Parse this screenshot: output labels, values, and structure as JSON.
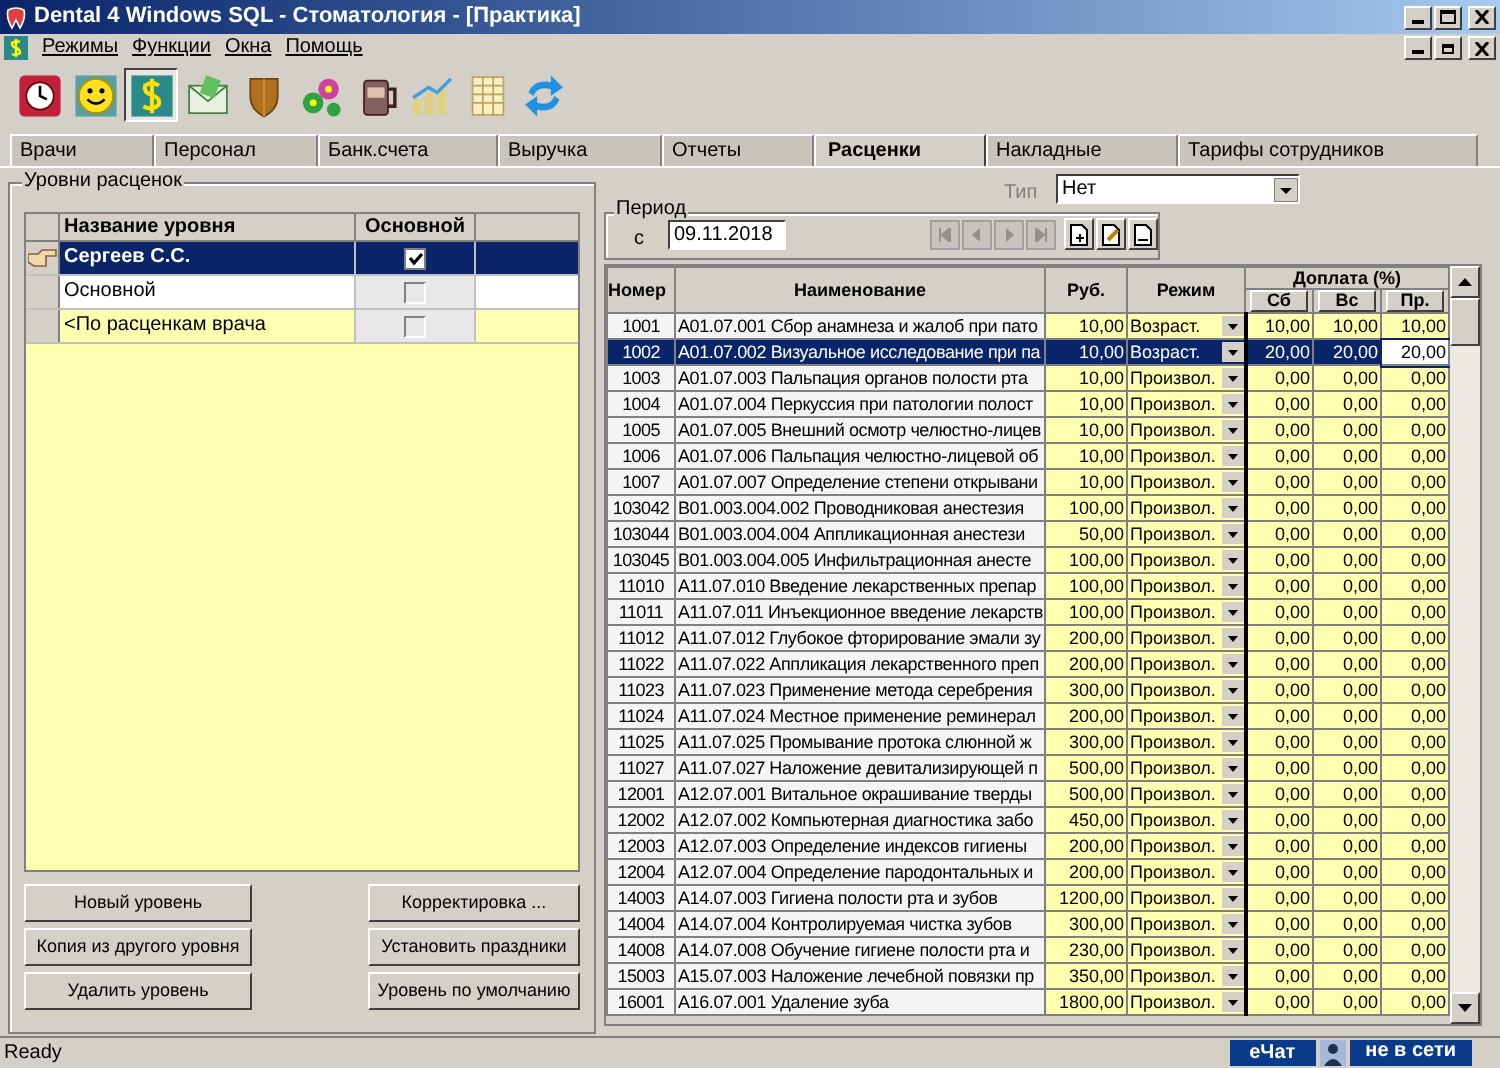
{
  "window": {
    "title": "Dental 4 Windows SQL - Стоматология - [Практика]"
  },
  "menu": [
    "Режимы",
    "Функции",
    "Окна",
    "Помощь"
  ],
  "toolbar": [
    {
      "kind": "clock",
      "selected": false
    },
    {
      "kind": "smiley",
      "selected": false
    },
    {
      "kind": "dollar",
      "selected": true
    },
    {
      "kind": "envelope",
      "selected": false
    },
    {
      "kind": "shield",
      "selected": false
    },
    {
      "kind": "flowers",
      "selected": false
    },
    {
      "kind": "jar",
      "selected": false
    },
    {
      "kind": "chart",
      "selected": false
    },
    {
      "kind": "table",
      "selected": false
    },
    {
      "kind": "refresh",
      "selected": false
    }
  ],
  "tabs": [
    {
      "label": "Врачи",
      "selected": false
    },
    {
      "label": "Персонал",
      "selected": false
    },
    {
      "label": "Банк.счета",
      "selected": false
    },
    {
      "label": "Выручка",
      "selected": false
    },
    {
      "label": "Отчеты",
      "selected": false
    },
    {
      "label": "Расценки",
      "selected": true
    },
    {
      "label": "Накладные",
      "selected": false
    },
    {
      "label": "Тарифы сотрудников",
      "selected": false
    }
  ],
  "levels_panel": {
    "title": "Уровни расценок",
    "columns": [
      "Название уровня",
      "Основной"
    ],
    "rows": [
      {
        "name": "Сергеев С.С.",
        "checked": true,
        "selected": true
      },
      {
        "name": "Основной",
        "checked": false,
        "selected": false
      },
      {
        "name": "<По расценкам врача",
        "checked": false,
        "selected": false
      }
    ],
    "buttons": [
      "Новый уровень",
      "Корректировка ...",
      "Копия из другого уровня",
      "Установить праздники",
      "Удалить уровень",
      "Уровень по умолчанию"
    ]
  },
  "type_field": {
    "label": "Тип",
    "value": "Нет"
  },
  "period": {
    "title": "Период",
    "from_label": "с",
    "date": "09.11.2018"
  },
  "prices": {
    "columns": {
      "number": "Номер",
      "name": "Наименование",
      "rub": "Руб.",
      "mode": "Режим",
      "surcharge": "Доплата (%)",
      "sat": "Сб",
      "sun": "Вс",
      "hol": "Пр."
    },
    "rows": [
      {
        "number": "1001",
        "name": "A01.07.001  Сбор анамнеза и жалоб при пато",
        "rub": "10,00",
        "mode": "Возраст.",
        "sat": "10,00",
        "sun": "10,00",
        "hol": "10,00",
        "selected": false
      },
      {
        "number": "1002",
        "name": "A01.07.002  Визуальное исследование при па",
        "rub": "10,00",
        "mode": "Возраст.",
        "sat": "20,00",
        "sun": "20,00",
        "hol": "20,00",
        "selected": true
      },
      {
        "number": "1003",
        "name": "A01.07.003  Пальпация органов полости рта",
        "rub": "10,00",
        "mode": "Произвол.",
        "sat": "0,00",
        "sun": "0,00",
        "hol": "0,00",
        "selected": false
      },
      {
        "number": "1004",
        "name": "A01.07.004  Перкуссия при патологии полост",
        "rub": "10,00",
        "mode": "Произвол.",
        "sat": "0,00",
        "sun": "0,00",
        "hol": "0,00",
        "selected": false
      },
      {
        "number": "1005",
        "name": "A01.07.005  Внешний осмотр челюстно-лицев",
        "rub": "10,00",
        "mode": "Произвол.",
        "sat": "0,00",
        "sun": "0,00",
        "hol": "0,00",
        "selected": false
      },
      {
        "number": "1006",
        "name": "A01.07.006  Пальпация челюстно-лицевой об",
        "rub": "10,00",
        "mode": "Произвол.",
        "sat": "0,00",
        "sun": "0,00",
        "hol": "0,00",
        "selected": false
      },
      {
        "number": "1007",
        "name": "A01.07.007  Определение степени открывани",
        "rub": "10,00",
        "mode": "Произвол.",
        "sat": "0,00",
        "sun": "0,00",
        "hol": "0,00",
        "selected": false
      },
      {
        "number": "103042",
        "name": "B01.003.004.002  Проводниковая анестезия",
        "rub": "100,00",
        "mode": "Произвол.",
        "sat": "0,00",
        "sun": "0,00",
        "hol": "0,00",
        "selected": false
      },
      {
        "number": "103044",
        "name": "B01.003.004.004  Аппликационная анестези",
        "rub": "50,00",
        "mode": "Произвол.",
        "sat": "0,00",
        "sun": "0,00",
        "hol": "0,00",
        "selected": false
      },
      {
        "number": "103045",
        "name": "B01.003.004.005  Инфильтрационная анесте",
        "rub": "100,00",
        "mode": "Произвол.",
        "sat": "0,00",
        "sun": "0,00",
        "hol": "0,00",
        "selected": false
      },
      {
        "number": "11010",
        "name": "A11.07.010  Введение лекарственных препар",
        "rub": "100,00",
        "mode": "Произвол.",
        "sat": "0,00",
        "sun": "0,00",
        "hol": "0,00",
        "selected": false
      },
      {
        "number": "11011",
        "name": "A11.07.011  Инъекционное введение лекарств",
        "rub": "100,00",
        "mode": "Произвол.",
        "sat": "0,00",
        "sun": "0,00",
        "hol": "0,00",
        "selected": false
      },
      {
        "number": "11012",
        "name": "A11.07.012  Глубокое фторирование эмали зу",
        "rub": "200,00",
        "mode": "Произвол.",
        "sat": "0,00",
        "sun": "0,00",
        "hol": "0,00",
        "selected": false
      },
      {
        "number": "11022",
        "name": "A11.07.022  Аппликация лекарственного преп",
        "rub": "200,00",
        "mode": "Произвол.",
        "sat": "0,00",
        "sun": "0,00",
        "hol": "0,00",
        "selected": false
      },
      {
        "number": "11023",
        "name": "A11.07.023  Применение метода серебрения",
        "rub": "300,00",
        "mode": "Произвол.",
        "sat": "0,00",
        "sun": "0,00",
        "hol": "0,00",
        "selected": false
      },
      {
        "number": "11024",
        "name": "A11.07.024  Местное применение реминерал",
        "rub": "200,00",
        "mode": "Произвол.",
        "sat": "0,00",
        "sun": "0,00",
        "hol": "0,00",
        "selected": false
      },
      {
        "number": "11025",
        "name": "A11.07.025  Промывание протока слюнной ж",
        "rub": "300,00",
        "mode": "Произвол.",
        "sat": "0,00",
        "sun": "0,00",
        "hol": "0,00",
        "selected": false
      },
      {
        "number": "11027",
        "name": "A11.07.027  Наложение девитализирующей п",
        "rub": "500,00",
        "mode": "Произвол.",
        "sat": "0,00",
        "sun": "0,00",
        "hol": "0,00",
        "selected": false
      },
      {
        "number": "12001",
        "name": "A12.07.001  Витальное окрашивание тверды",
        "rub": "500,00",
        "mode": "Произвол.",
        "sat": "0,00",
        "sun": "0,00",
        "hol": "0,00",
        "selected": false
      },
      {
        "number": "12002",
        "name": "A12.07.002  Компьютерная диагностика забо",
        "rub": "450,00",
        "mode": "Произвол.",
        "sat": "0,00",
        "sun": "0,00",
        "hol": "0,00",
        "selected": false
      },
      {
        "number": "12003",
        "name": "A12.07.003  Определение индексов гигиены",
        "rub": "200,00",
        "mode": "Произвол.",
        "sat": "0,00",
        "sun": "0,00",
        "hol": "0,00",
        "selected": false
      },
      {
        "number": "12004",
        "name": "A12.07.004  Определение пародонтальных и",
        "rub": "200,00",
        "mode": "Произвол.",
        "sat": "0,00",
        "sun": "0,00",
        "hol": "0,00",
        "selected": false
      },
      {
        "number": "14003",
        "name": "A14.07.003  Гигиена полости рта и зубов",
        "rub": "1200,00",
        "mode": "Произвол.",
        "sat": "0,00",
        "sun": "0,00",
        "hol": "0,00",
        "selected": false
      },
      {
        "number": "14004",
        "name": "A14.07.004 Контролируемая чистка зубов",
        "rub": "300,00",
        "mode": "Произвол.",
        "sat": "0,00",
        "sun": "0,00",
        "hol": "0,00",
        "selected": false
      },
      {
        "number": "14008",
        "name": "A14.07.008  Обучение гигиене полости рта и",
        "rub": "230,00",
        "mode": "Произвол.",
        "sat": "0,00",
        "sun": "0,00",
        "hol": "0,00",
        "selected": false
      },
      {
        "number": "15003",
        "name": "A15.07.003  Наложение лечебной повязки пр",
        "rub": "350,00",
        "mode": "Произвол.",
        "sat": "0,00",
        "sun": "0,00",
        "hol": "0,00",
        "selected": false
      },
      {
        "number": "16001",
        "name": "A16.07.001  Удаление зуба",
        "rub": "1800,00",
        "mode": "Произвол.",
        "sat": "0,00",
        "sun": "0,00",
        "hol": "0,00",
        "selected": false
      }
    ]
  },
  "status_bar": {
    "text": "Ready",
    "chat": "еЧат",
    "network": "не в сети"
  }
}
